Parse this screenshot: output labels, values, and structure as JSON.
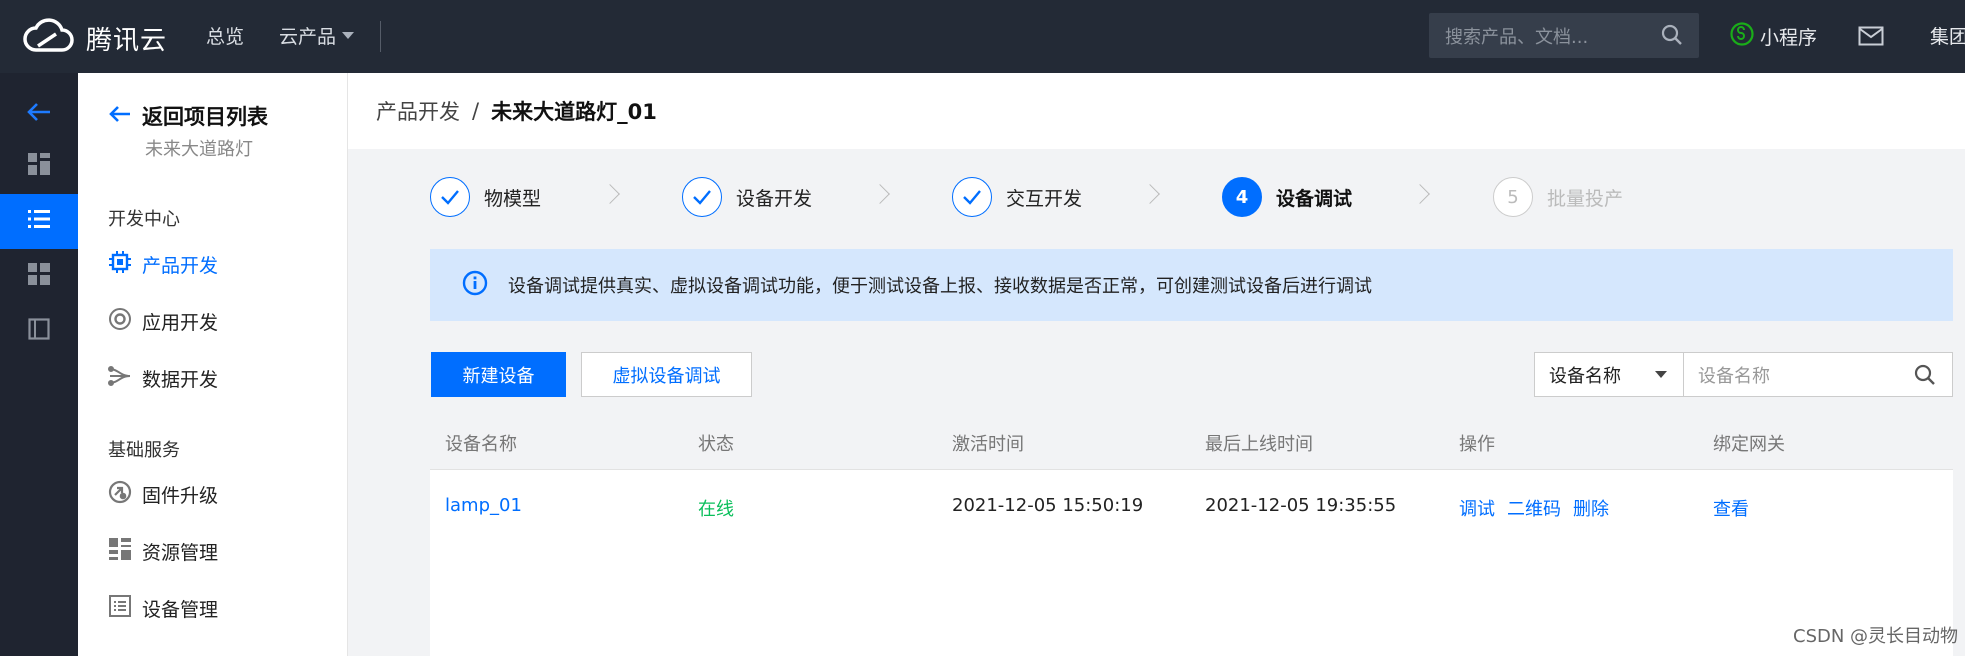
{
  "topbar": {
    "brand": "腾讯云",
    "nav": [
      {
        "label": "总览"
      },
      {
        "label": "云产品"
      }
    ],
    "search_placeholder": "搜索产品、文档...",
    "mini_program": "小程序",
    "group": "集团"
  },
  "sidebar": {
    "back_label": "返回项目列表",
    "project_name": "未来大道路灯",
    "section_dev": "开发中心",
    "dev_items": [
      {
        "label": "产品开发",
        "icon": "chip-icon",
        "active": true
      },
      {
        "label": "应用开发",
        "icon": "app-icon"
      },
      {
        "label": "数据开发",
        "icon": "data-flow-icon"
      }
    ],
    "section_base": "基础服务",
    "base_items": [
      {
        "label": "固件升级",
        "icon": "firmware-icon"
      },
      {
        "label": "资源管理",
        "icon": "resource-icon"
      },
      {
        "label": "设备管理",
        "icon": "device-list-icon"
      }
    ]
  },
  "breadcrumb": {
    "parent": "产品开发",
    "separator": "/",
    "current": "未来大道路灯_01"
  },
  "steps": [
    {
      "label": "物模型",
      "state": "done"
    },
    {
      "label": "设备开发",
      "state": "done"
    },
    {
      "label": "交互开发",
      "state": "done"
    },
    {
      "label": "设备调试",
      "state": "current",
      "number": "4"
    },
    {
      "label": "批量投产",
      "state": "pending",
      "number": "5"
    }
  ],
  "alert": {
    "text": "设备调试提供真实、虚拟设备调试功能，便于测试设备上报、接收数据是否正常，可创建测试设备后进行调试"
  },
  "toolbar": {
    "new_device": "新建设备",
    "virtual_debug": "虚拟设备调试",
    "filter_select": "设备名称",
    "filter_placeholder": "设备名称"
  },
  "table": {
    "headers": [
      "设备名称",
      "状态",
      "激活时间",
      "最后上线时间",
      "操作",
      "绑定网关"
    ],
    "rows": [
      {
        "name": "lamp_01",
        "status": "在线",
        "activated": "2021-12-05 15:50:19",
        "last_online": "2021-12-05 19:35:55",
        "ops": [
          "调试",
          "二维码",
          "删除"
        ],
        "gateway": "查看"
      }
    ]
  },
  "watermark": "CSDN @灵长目动物",
  "colors": {
    "accent": "#006eff",
    "online": "#0abf5b",
    "topbar": "#232a36"
  }
}
